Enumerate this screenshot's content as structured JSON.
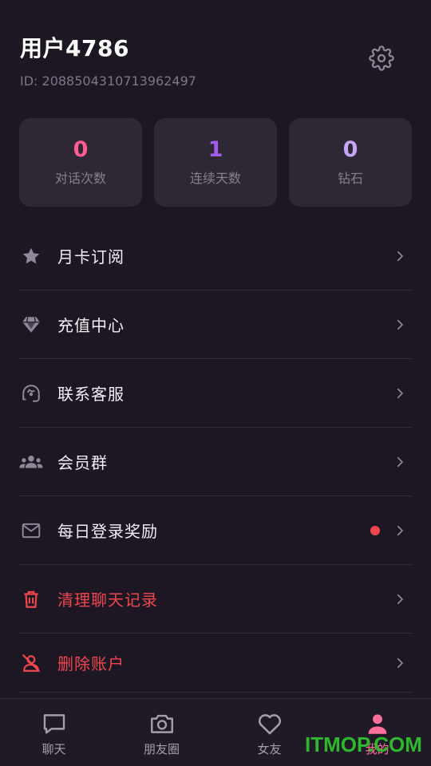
{
  "header": {
    "username": "用户4786",
    "user_id": "ID: 2088504310713962497",
    "settings_icon": "gear-icon"
  },
  "stats": [
    {
      "value": "0",
      "label": "对话次数",
      "color": "#ff5c94"
    },
    {
      "value": "1",
      "label": "连续天数",
      "color": "#a25cf2"
    },
    {
      "value": "0",
      "label": "钻石",
      "color": "#c7a4f5"
    }
  ],
  "menu": [
    {
      "label": "月卡订阅",
      "icon": "star-icon",
      "danger": false
    },
    {
      "label": "充值中心",
      "icon": "diamond-icon",
      "danger": false
    },
    {
      "label": "联系客服",
      "icon": "headset-icon",
      "danger": false
    },
    {
      "label": "会员群",
      "icon": "group-icon",
      "danger": false
    },
    {
      "label": "每日登录奖励",
      "icon": "mail-icon",
      "danger": false,
      "badge_color": "#f0474f"
    },
    {
      "label": "清理聊天记录",
      "icon": "trash-icon",
      "danger": true
    },
    {
      "label": "删除账户",
      "icon": "user-delete-icon",
      "danger": true
    }
  ],
  "tabs": [
    {
      "label": "聊天",
      "icon": "chat-icon",
      "active": false
    },
    {
      "label": "朋友圈",
      "icon": "camera-icon",
      "active": false
    },
    {
      "label": "女友",
      "icon": "heart-icon",
      "active": false
    },
    {
      "label": "我的",
      "icon": "person-icon",
      "active": true
    }
  ],
  "colors": {
    "background": "#1c1722",
    "card": "#2d2833",
    "icon_gray": "#8e8898",
    "danger": "#f0474f",
    "accent": "#ff6f9c"
  },
  "watermark": "ITMOP.COM"
}
